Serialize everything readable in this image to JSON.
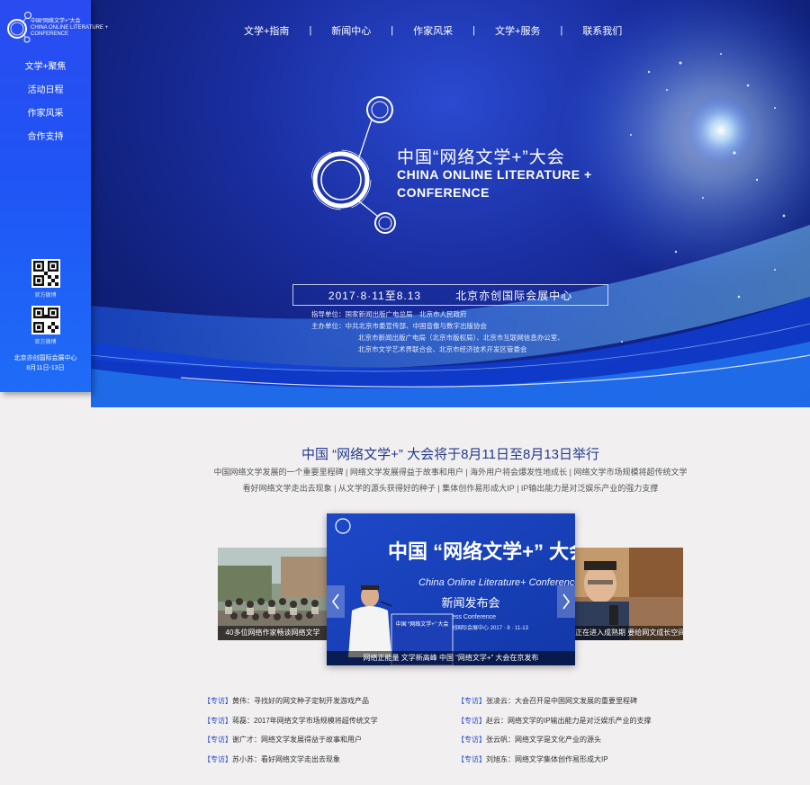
{
  "sidebar": {
    "logo": {
      "line1": "中国“网络文学+”大会",
      "line2": "CHINA ONLINE LITERATURE +",
      "line3": "CONFERENCE"
    },
    "nav": [
      "文学+聚焦",
      "活动日程",
      "作家风采",
      "合作支持"
    ],
    "qr_codes": [
      {
        "label": "官方微博",
        "icon": "qr-code-icon"
      },
      {
        "label": "官方微博",
        "icon": "qr-code-icon"
      }
    ],
    "footer_venue": "北京亦创国际会展中心",
    "footer_dates": "8月11日-13日"
  },
  "top_nav": [
    "文学+指南",
    "新闻中心",
    "作家风采",
    "文学+服务",
    "联系我们"
  ],
  "top_nav_separator": "|",
  "banner": {
    "title_cn": "中国“网络文学+”大会",
    "title_en_1": "CHINA ONLINE LITERATURE +",
    "title_en_2": "CONFERENCE",
    "date": "2017·8·11至8.13",
    "venue": "北京亦创国际会展中心",
    "org_lines": [
      "指导单位：国家新闻出版广电总局　北京市人民政府",
      "主办单位：中共北京市委宣传部、中国音像与数字出版协会",
      "北京市新闻出版广电局（北京市版权局）、北京市互联网信息办公室、",
      "北京市文学艺术界联合会、北京市经济技术开发区管委会"
    ]
  },
  "content": {
    "headline": "中国 “网络文学+” 大会将于8月11日至8月13日举行",
    "subline_1": "中国网络文学发展的一个重要里程碑 |  网络文学发展得益于故事和用户 |  海外用户将会爆发性地成长 |  网络文学市场规模将超传统文学",
    "subline_2": "看好网络文学走出去现象 |  从文学的源头获得好的种子 |  集体创作易形成大IP |  IP输出能力是对泛娱乐产业的强力支撑"
  },
  "carousel": {
    "left_caption": "40多位网络作家畅谈网络文学",
    "main_caption": "网络正能量 文学新高峰 中国 “网络文学+” 大会在京发布",
    "right_caption": "正在进入成熟期 要给网文成长空间",
    "poster": {
      "title": "中国 “网络文学+” 大会",
      "subtitle_en": "China Online Literature+ Conference",
      "event": "新闻发布会",
      "event_en": "Press Conference",
      "venue_date": "北京亦创国际会展中心 2017 · 8 · 11-13",
      "podium": "中国 “网络文学+” 大会"
    }
  },
  "news": {
    "tag": "【专访】",
    "left": [
      "黄伟：寻找好的网文种子定制开发游戏产品",
      "蒋磊：2017年网络文学市场规模将超传统文学",
      "谢广才：网络文学发展得益于故事和用户",
      "苏小苏：看好网络文学走出去现象"
    ],
    "right": [
      "张凌云：大会召开是中国网文发展的重要里程碑",
      "赵云：网络文学的IP输出能力是对泛娱乐产业的支撑",
      "张云帆：网络文学是文化产业的源头",
      "刘旭东：网络文学集体创作易形成大IP"
    ]
  },
  "colors": {
    "sidebar": "#1f55f5",
    "banner_dark": "#10207a",
    "headline": "#253a8c",
    "tag": "#2a4cd0",
    "page_bg": "#f1eff0"
  }
}
